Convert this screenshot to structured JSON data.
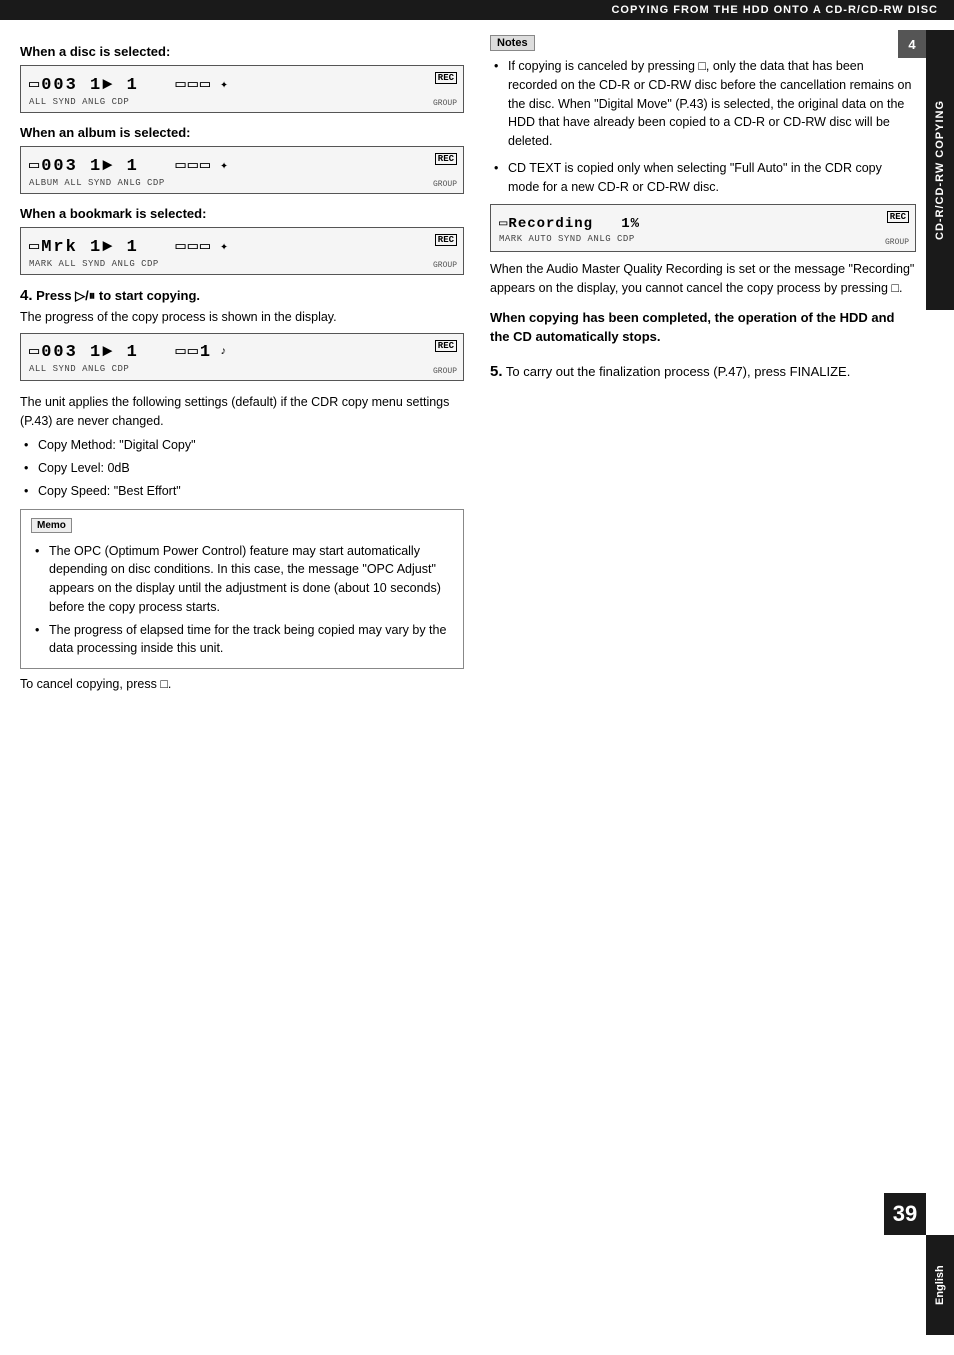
{
  "header": {
    "title": "COPYING FROM THE HDD ONTO A CD-R/CD-RW DISC"
  },
  "right_sidebar": {
    "label": "CD-R/CD-RW COPYING"
  },
  "bottom_sidebar": {
    "label": "English"
  },
  "page_number": "39",
  "chapter_number": "4",
  "left_column": {
    "disc_selected": {
      "heading": "When a disc is selected:",
      "display_main": "0003  1▶  1    000",
      "display_sub": "ALL SYND ANLG  CDP",
      "rec": "REC",
      "group": "GROUP"
    },
    "album_selected": {
      "heading": "When an album is selected:",
      "display_main": "0003  1▶  1    000",
      "display_sub": "ALBUM  ALL SYND ANLG  CDP",
      "rec": "REC",
      "group": "GROUP"
    },
    "bookmark_selected": {
      "heading": "When a bookmark is selected:",
      "display_main": "Mrk  1▶  1    000",
      "display_sub": "MARK  ALL SYND ANLG  CDP",
      "rec": "REC",
      "group": "GROUP"
    },
    "step4": {
      "number": "4.",
      "heading": "Press ▷/⏸ to start copying.",
      "body": "The progress of the copy process is shown in the display.",
      "display_main": "0003  1▶  1    001",
      "display_sub": "ALL SYND ANLG  CDP",
      "rec": "REC",
      "group": "GROUP"
    },
    "default_settings_intro": "The unit applies the following settings (default) if the CDR copy menu settings (P.43) are never changed.",
    "default_settings": [
      "Copy Method:   \"Digital Copy\"",
      "Copy Level:    0dB",
      "Copy Speed:    \"Best Effort\""
    ],
    "memo": {
      "label": "Memo",
      "bullets": [
        "The OPC (Optimum Power Control) feature may start automatically depending on disc conditions. In this case, the message \"OPC Adjust\" appears on the display until the adjustment is done (about 10 seconds) before the copy process starts.",
        "The progress of elapsed time for the track being copied may vary by the data processing inside this unit."
      ]
    },
    "cancel_note": "To cancel copying, press □."
  },
  "right_column": {
    "notes_label": "Notes",
    "bullets": [
      "If copying is canceled by pressing □, only the data that has been recorded on the CD-R or CD-RW disc before the cancellation remains on the disc. When \"Digital Move\" (P.43) is selected, the original data on the HDD that have already been copied to a CD-R or CD-RW disc will be deleted.",
      "CD TEXT is copied only when selecting \"Full Auto\" in the CDR copy mode for a new CD-R or CD-RW disc."
    ],
    "recording_display": {
      "main": "Recording  1%",
      "sub": "MARK  AUTO SYND ANLG  CDP",
      "rec": "REC",
      "group": "GROUP"
    },
    "recording_note": "When the Audio Master Quality Recording is set or the message \"Recording\" appears on the display, you cannot cancel the copy process by pressing □.",
    "completed_heading": "When copying has been completed, the operation of the HDD and the CD automatically stops.",
    "step5": {
      "number": "5.",
      "text": "To carry out the finalization process (P.47), press FINALIZE."
    }
  }
}
